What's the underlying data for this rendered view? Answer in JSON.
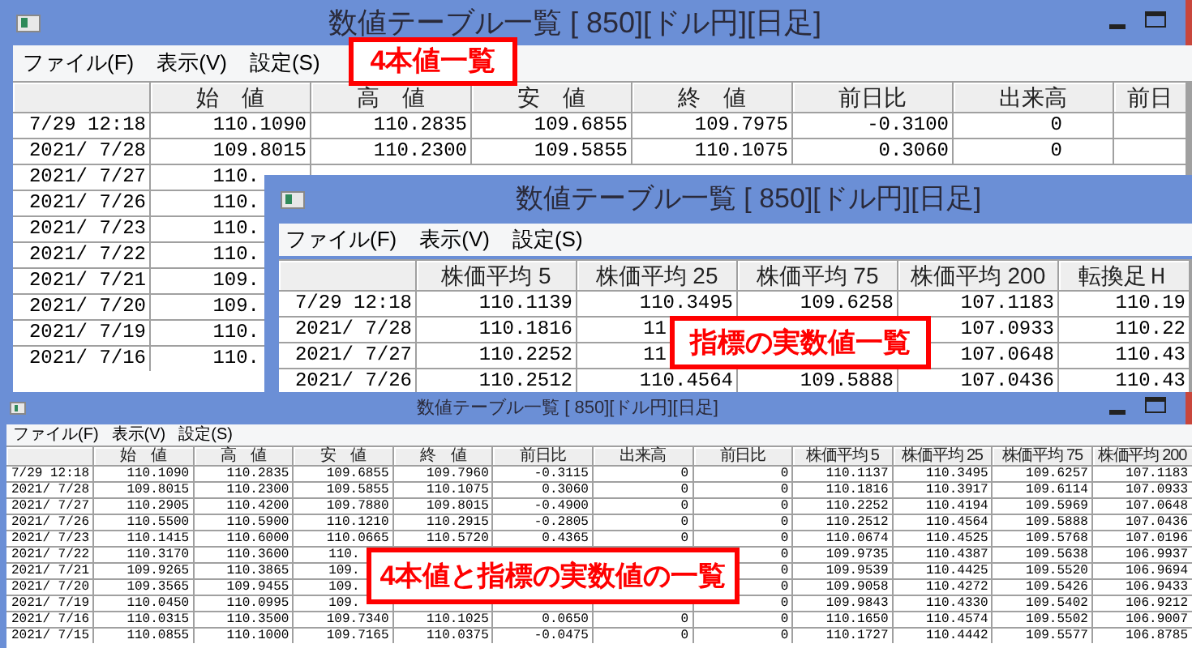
{
  "windows": [
    {
      "title": "数値テーブル一覧 [ 850][ドル円][日足]",
      "menu": [
        "ファイル(F)",
        "表示(V)",
        "設定(S)"
      ],
      "callout": "4本値一覧",
      "columns": [
        "",
        "始　値",
        "高　値",
        "安　値",
        "終　値",
        "前日比",
        "出来高",
        "前日"
      ],
      "rows": [
        {
          "cells": [
            "7/29 12:18",
            "110.1090",
            "110.2835",
            "109.6855",
            "109.7975",
            "-0.3100",
            "0",
            null
          ]
        },
        {
          "cells": [
            "2021/ 7/28",
            "109.8015",
            "110.2300",
            "109.5855",
            "110.1075",
            "0.3060",
            "0",
            null
          ]
        },
        {
          "cells": [
            "2021/ 7/27",
            "110."
          ]
        },
        {
          "cells": [
            "2021/ 7/26",
            "110."
          ]
        },
        {
          "cells": [
            "2021/ 7/23",
            "110."
          ]
        },
        {
          "cells": [
            "2021/ 7/22",
            "110."
          ]
        },
        {
          "cells": [
            "2021/ 7/21",
            "109."
          ]
        },
        {
          "cells": [
            "2021/ 7/20",
            "109."
          ]
        },
        {
          "cells": [
            "2021/ 7/19",
            "110."
          ]
        },
        {
          "cells": [
            "2021/ 7/16",
            "110."
          ]
        }
      ]
    },
    {
      "title": "数値テーブル一覧 [ 850][ドル円][日足]",
      "menu": [
        "ファイル(F)",
        "表示(V)",
        "設定(S)"
      ],
      "callout": "指標の実数値一覧",
      "columns": [
        "",
        "株価平均 5",
        "株価平均 25",
        "株価平均 75",
        "株価平均 200",
        "転換足Ｈ"
      ],
      "rows": [
        {
          "cells": [
            "7/29 12:18",
            "110.1139",
            "110.3495",
            "109.6258",
            "107.1183",
            "110.19"
          ]
        },
        {
          "cells": [
            "2021/ 7/28",
            "110.1816",
            "11",
            null,
            "107.0933",
            "110.22"
          ]
        },
        {
          "cells": [
            "2021/ 7/27",
            "110.2252",
            "11",
            null,
            "107.0648",
            "110.43"
          ]
        },
        {
          "cells": [
            "2021/ 7/26",
            "110.2512",
            "110.4564",
            "109.5888",
            "107.0436",
            "110.43"
          ]
        }
      ]
    },
    {
      "title": "数値テーブル一覧 [ 850][ドル円][日足]",
      "menu": [
        "ファイル(F)",
        "表示(V)",
        "設定(S)"
      ],
      "callout": "4本値と指標の実数値の一覧",
      "columns": [
        "",
        "始　値",
        "高　値",
        "安　値",
        "終　値",
        "前日比",
        "出来高",
        "前日比",
        "株価平均 5",
        "株価平均 25",
        "株価平均 75",
        "株価平均 200"
      ],
      "rows": [
        {
          "cells": [
            "7/29 12:18",
            "110.1090",
            "110.2835",
            "109.6855",
            "109.7960",
            "-0.3115",
            "0",
            "0",
            "110.1137",
            "110.3495",
            "109.6257",
            "107.1183"
          ]
        },
        {
          "cells": [
            "2021/ 7/28",
            "109.8015",
            "110.2300",
            "109.5855",
            "110.1075",
            "0.3060",
            "0",
            "0",
            "110.1816",
            "110.3917",
            "109.6114",
            "107.0933"
          ]
        },
        {
          "cells": [
            "2021/ 7/27",
            "110.2905",
            "110.4200",
            "109.7880",
            "109.8015",
            "-0.4900",
            "0",
            "0",
            "110.2252",
            "110.4194",
            "109.5969",
            "107.0648"
          ]
        },
        {
          "cells": [
            "2021/ 7/26",
            "110.5500",
            "110.5900",
            "110.1210",
            "110.2915",
            "-0.2805",
            "0",
            "0",
            "110.2512",
            "110.4564",
            "109.5888",
            "107.0436"
          ]
        },
        {
          "cells": [
            "2021/ 7/23",
            "110.1415",
            "110.6000",
            "110.0665",
            "110.5720",
            "0.4365",
            "0",
            "0",
            "110.0674",
            "110.4525",
            "109.5768",
            "107.0196"
          ]
        },
        {
          "cells": [
            "2021/ 7/22",
            "110.3170",
            "110.3600",
            "110.",
            null,
            null,
            null,
            "0",
            "109.9735",
            "110.4387",
            "109.5638",
            "106.9937"
          ]
        },
        {
          "cells": [
            "2021/ 7/21",
            "109.9265",
            "110.3865",
            "109.",
            null,
            null,
            null,
            "0",
            "109.9539",
            "110.4425",
            "109.5520",
            "106.9694"
          ]
        },
        {
          "cells": [
            "2021/ 7/20",
            "109.3565",
            "109.9455",
            "109.",
            null,
            null,
            null,
            "0",
            "109.9058",
            "110.4272",
            "109.5426",
            "106.9433"
          ]
        },
        {
          "cells": [
            "2021/ 7/19",
            "110.0450",
            "110.0995",
            "109.",
            null,
            null,
            null,
            "0",
            "109.9843",
            "110.4330",
            "109.5402",
            "106.9212"
          ]
        },
        {
          "cells": [
            "2021/ 7/16",
            "110.0315",
            "110.3500",
            "109.7340",
            "110.1025",
            "0.0650",
            "0",
            "0",
            "110.1650",
            "110.4574",
            "109.5502",
            "106.9007"
          ]
        },
        {
          "cells": [
            "2021/ 7/15",
            "110.0855",
            "110.1000",
            "109.7165",
            "110.0375",
            "-0.0475",
            "0",
            "0",
            "110.1727",
            "110.4442",
            "109.5577",
            "106.8785"
          ]
        }
      ]
    }
  ]
}
